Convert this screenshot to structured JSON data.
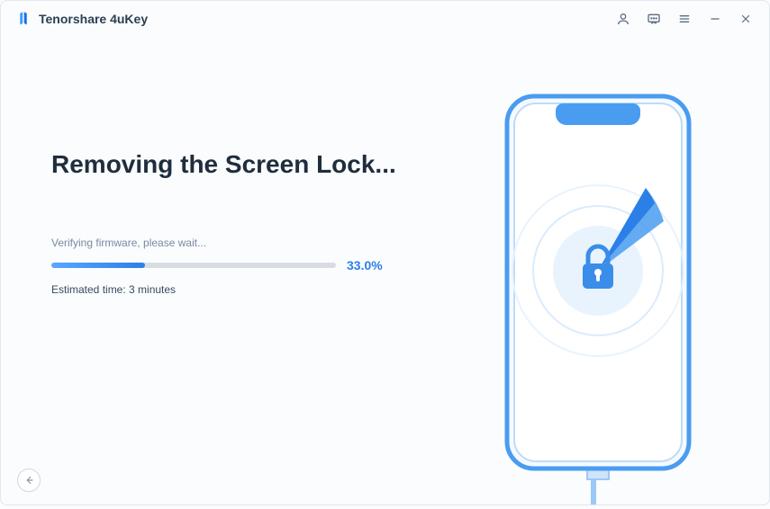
{
  "app": {
    "title": "Tenorshare 4uKey"
  },
  "heading": "Removing the Screen Lock...",
  "status": "Verifying firmware, please wait...",
  "progress": {
    "percent": "33.0%",
    "value": 33.0,
    "estimated": "Estimated time: 3 minutes"
  }
}
